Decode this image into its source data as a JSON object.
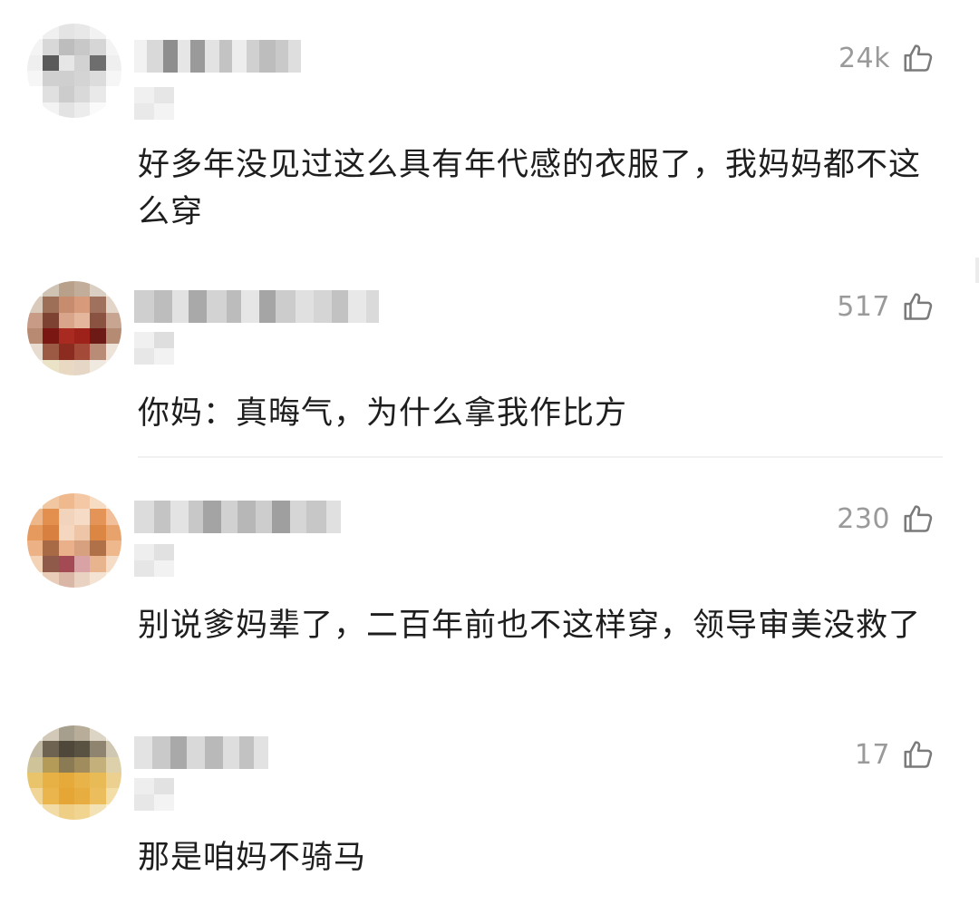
{
  "comments": [
    {
      "likes": "24k",
      "text": "好多年没见过这么具有年代感的衣服了，我妈妈都不这么穿",
      "avatar_colors": [
        "#ffffff",
        "#f0f0f0",
        "#e4e4e4",
        "#e8e8e8",
        "#f2f2f2",
        "#ffffff",
        "#f4f4f4",
        "#d8d8d8",
        "#bdbdbd",
        "#c8c8c8",
        "#d6d6d6",
        "#f4f4f4",
        "#efefef",
        "#5a5a5a",
        "#e6e6e6",
        "#d2d2d2",
        "#6e6e6e",
        "#efefef",
        "#f6f6f6",
        "#d0d0d0",
        "#cfcfcf",
        "#d4d4d4",
        "#dcdcdc",
        "#f6f6f6",
        "#ffffff",
        "#e0e0e0",
        "#cccccc",
        "#d9d9d9",
        "#e9e9e9",
        "#ffffff",
        "#ffffff",
        "#f3f3f3",
        "#e3e3e3",
        "#ececec",
        "#fafafa",
        "#ffffff"
      ]
    },
    {
      "likes": "517",
      "text": "你妈：真晦气，为什么拿我作比方",
      "avatar_colors": [
        "#f3efe9",
        "#cfc3b4",
        "#b9a08a",
        "#c2ad9a",
        "#d9cfc3",
        "#f3efe9",
        "#d9cabc",
        "#9d6f57",
        "#c78b6d",
        "#d79b7b",
        "#a0725e",
        "#e3d6c9",
        "#c79b86",
        "#7d4232",
        "#d8a58b",
        "#e4b79c",
        "#8a5241",
        "#c8a590",
        "#b98a72",
        "#7a1712",
        "#a82a20",
        "#9e2219",
        "#6d1a16",
        "#b58b74",
        "#e8dcd0",
        "#9c5a45",
        "#8c2b20",
        "#a44a38",
        "#b98c78",
        "#ede3d8",
        "#f7f3ee",
        "#eae3c8",
        "#e9d9c2",
        "#e6d6c6",
        "#f0e9e0",
        "#f7f3ee"
      ]
    },
    {
      "likes": "230",
      "text": "别说爹妈辈了，二百年前也不这样穿，领导审美没救了",
      "avatar_colors": [
        "#fbf2ea",
        "#f1c7a2",
        "#f0b98d",
        "#f4c8a4",
        "#f7dcc4",
        "#fbf2ea",
        "#eeb789",
        "#e3904f",
        "#f2d3bb",
        "#f6dcc7",
        "#e59458",
        "#f1c09a",
        "#e69a5e",
        "#d7803f",
        "#f5d6bf",
        "#efc5a8",
        "#dc8644",
        "#e8a26c",
        "#ecb285",
        "#a86a44",
        "#e9b08a",
        "#d7a07e",
        "#b07048",
        "#eeb78c",
        "#f3d2b6",
        "#8f5a4a",
        "#a44a55",
        "#d9a3a6",
        "#e7b48e",
        "#f5dcc6",
        "#fbf2ea",
        "#e9cdb8",
        "#d9b6a5",
        "#ead2c2",
        "#f4e2d2",
        "#fbf2ea"
      ]
    },
    {
      "likes": "17",
      "text": "那是咱妈不骑马",
      "avatar_colors": [
        "#f4f1ea",
        "#d2c9b8",
        "#a79f8d",
        "#b7ad99",
        "#dcd4c4",
        "#f4f1ea",
        "#c2b9a4",
        "#6d6350",
        "#4f473a",
        "#595142",
        "#8e8470",
        "#d0c7b2",
        "#cfc39a",
        "#b59b58",
        "#8b7b54",
        "#a08c5c",
        "#c4b07a",
        "#ddd1ac",
        "#e9c46a",
        "#e8b145",
        "#e6aa3b",
        "#e8b349",
        "#e9bb57",
        "#ecd08f",
        "#f1d596",
        "#eab54c",
        "#e6a636",
        "#e8ad41",
        "#ebbd5c",
        "#f3dea8",
        "#f8f2e4",
        "#f2dba4",
        "#efcf85",
        "#f0d48f",
        "#f4e2b7",
        "#f8f2e4"
      ]
    }
  ]
}
